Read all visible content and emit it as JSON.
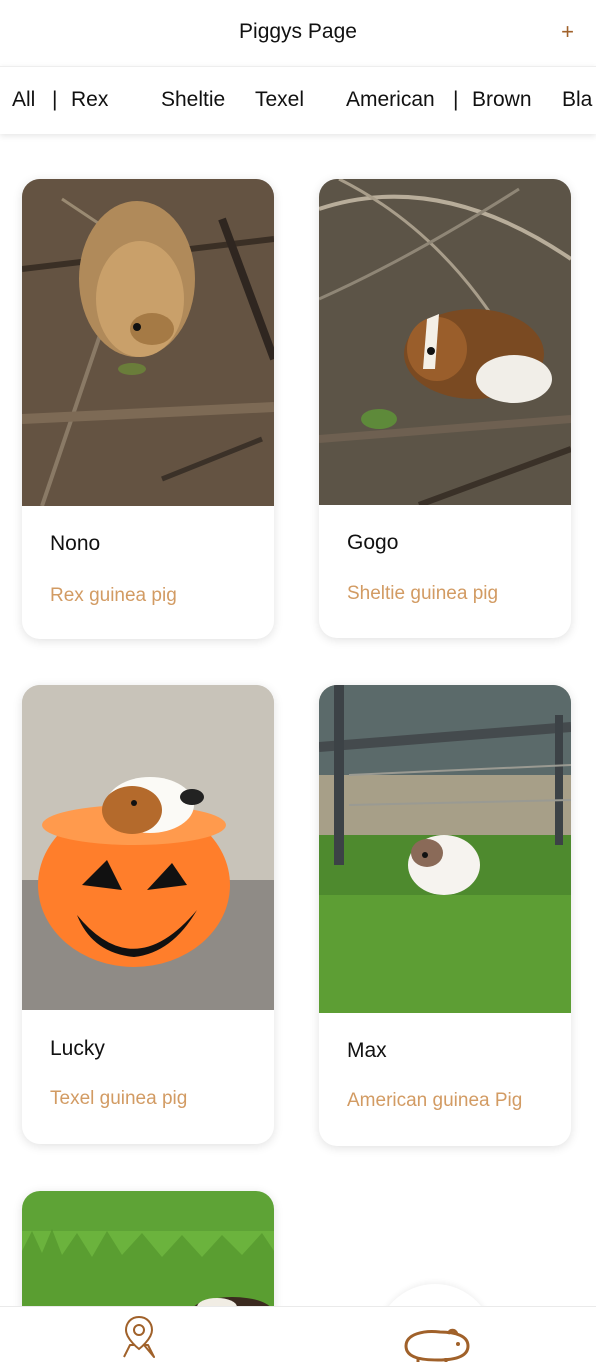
{
  "header": {
    "title": "Piggys Page",
    "add_label": "+"
  },
  "tabs": {
    "items": [
      "All",
      "Rex",
      "Sheltie",
      "Texel",
      "American",
      "Brown",
      "Bla"
    ],
    "separator": "|"
  },
  "cards": [
    {
      "name": "Nono",
      "breed": "Rex guinea pig"
    },
    {
      "name": "Gogo",
      "breed": "Sheltie guinea pig"
    },
    {
      "name": "Lucky",
      "breed": "Texel guinea pig"
    },
    {
      "name": "Max",
      "breed": "American guinea Pig"
    }
  ],
  "colors": {
    "accent": "#a0612a",
    "breed_text": "#d29b63"
  },
  "bottom_nav": {
    "icons": [
      "map-pin-icon",
      "guinea-pig-icon"
    ]
  }
}
